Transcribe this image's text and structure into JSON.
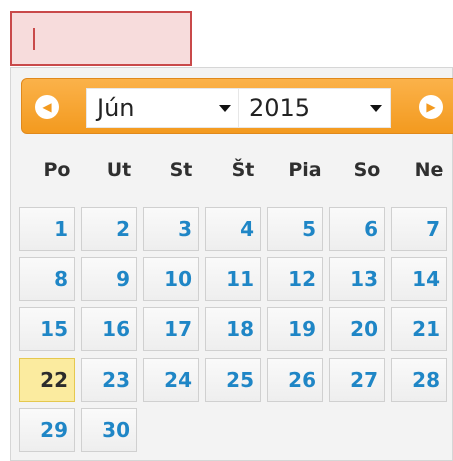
{
  "date_input": {
    "value": ""
  },
  "datepicker": {
    "prev_icon": "chevron-left-circle-icon",
    "next_icon": "chevron-right-circle-icon",
    "month": "Jún",
    "year": "2015",
    "weekdays": [
      "Po",
      "Ut",
      "St",
      "Št",
      "Pia",
      "So",
      "Ne"
    ],
    "days": [
      "1",
      "2",
      "3",
      "4",
      "5",
      "6",
      "7",
      "8",
      "9",
      "10",
      "11",
      "12",
      "13",
      "14",
      "15",
      "16",
      "17",
      "18",
      "19",
      "20",
      "21",
      "22",
      "23",
      "24",
      "25",
      "26",
      "27",
      "28",
      "29",
      "30"
    ],
    "highlighted_day": "22",
    "colors": {
      "header": "#f39a1f",
      "day_text": "#1f86c6",
      "today_bg": "#fbeb9f",
      "input_error_border": "#c9494a",
      "input_error_bg": "#f7dcdc"
    }
  }
}
